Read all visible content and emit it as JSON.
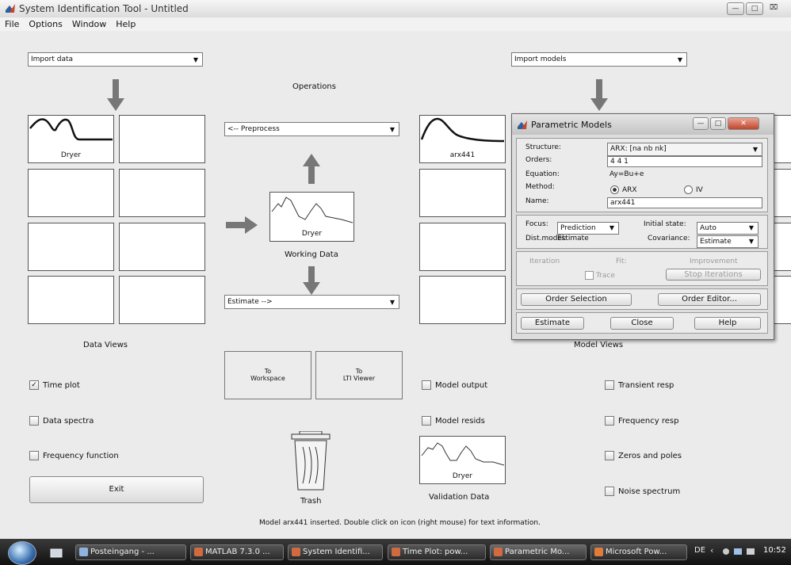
{
  "window": {
    "title": "System Identification Tool - Untitled"
  },
  "menu": [
    "File",
    "Options",
    "Window",
    "Help"
  ],
  "import_data": "Import data",
  "import_models": "Import models",
  "operations": {
    "title": "Operations",
    "preprocess": "<-- Preprocess",
    "estimate": "Estimate -->",
    "working_data_tile": "Dryer",
    "working_data_label": "Working Data"
  },
  "data_views": {
    "title": "Data Views",
    "tile1": "Dryer"
  },
  "model_views": {
    "title": "Model Views",
    "tile1": "arx441"
  },
  "export": {
    "workspace": "To\nWorkspace",
    "lti": "To\nLTI Viewer"
  },
  "data_checks": [
    {
      "label": "Time plot",
      "checked": true
    },
    {
      "label": "Data spectra",
      "checked": false
    },
    {
      "label": "Frequency function",
      "checked": false
    }
  ],
  "model_checks_left": [
    {
      "label": "Model output",
      "checked": false
    },
    {
      "label": "Model resids",
      "checked": false
    }
  ],
  "model_checks_right": [
    {
      "label": "Transient resp",
      "checked": false
    },
    {
      "label": "Frequency resp",
      "checked": false
    },
    {
      "label": "Zeros and poles",
      "checked": false
    },
    {
      "label": "Noise spectrum",
      "checked": false
    }
  ],
  "exit": "Exit",
  "trash": "Trash",
  "validation": {
    "tile": "Dryer",
    "label": "Validation Data"
  },
  "status": "Model arx441 inserted.  Double click on icon (right mouse) for text information.",
  "dialog": {
    "title": "Parametric Models",
    "structure_label": "Structure:",
    "structure_value": "ARX: [na nb nk]",
    "orders_label": "Orders:",
    "orders_value": "4 4 1",
    "equation_label": "Equation:",
    "equation_value": "Ay=Bu+e",
    "method_label": "Method:",
    "method_arx": "ARX",
    "method_iv": "IV",
    "name_label": "Name:",
    "name_value": "arx441",
    "focus_label": "Focus:",
    "focus_value": "Prediction",
    "initial_state_label": "Initial state:",
    "initial_state_value": "Auto",
    "distmodel_label": "Dist.model:",
    "distmodel_value": "Estimate",
    "covariance_label": "Covariance:",
    "covariance_value": "Estimate",
    "iteration": "Iteration",
    "fit": "Fit:",
    "improvement": "Improvement",
    "trace": "Trace",
    "stop_iterations": "Stop Iterations",
    "order_selection": "Order Selection",
    "order_editor": "Order Editor...",
    "estimate": "Estimate",
    "close": "Close",
    "help": "Help"
  },
  "taskbar": {
    "items": [
      "Posteingang - ...",
      "MATLAB 7.3.0 ...",
      "System Identifi...",
      "Time Plot: pow...",
      "Parametric Mo...",
      "Microsoft Pow..."
    ],
    "lang": "DE",
    "clock": "10:52"
  }
}
